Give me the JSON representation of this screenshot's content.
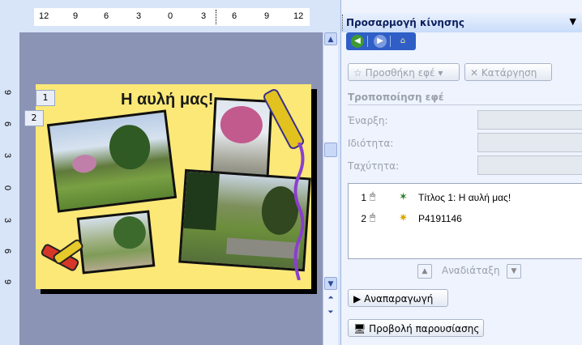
{
  "ruler": {
    "h_ticks": [
      "12",
      "9",
      "6",
      "3",
      "0",
      "3",
      "6",
      "9",
      "12"
    ],
    "v_ticks": [
      "9",
      "6",
      "3",
      "0",
      "3",
      "6",
      "9"
    ]
  },
  "slide": {
    "title": "Η αυλή μας!",
    "tags": [
      "1",
      "2"
    ],
    "background": "#fbe877"
  },
  "pane": {
    "title": "Προσαρμογή κίνησης",
    "menu_icon": "chevron-down-icon",
    "nav": [
      "back-icon",
      "forward-icon",
      "home-icon"
    ],
    "add_effect": "Προσθήκη εφέ",
    "remove": "Κατάργηση",
    "modify_heading": "Τροποποίηση εφέ",
    "start_label": "Έναρξη:",
    "property_label": "Ιδιότητα:",
    "speed_label": "Ταχύτητα:",
    "items": [
      {
        "num": "1",
        "text": "Τίτλος 1: Η αυλή μας!"
      },
      {
        "num": "2",
        "text": "P4191146"
      }
    ],
    "reorder_label": "Αναδιάταξη",
    "play_label": "Αναπαραγωγή",
    "slideshow_label": "Προβολή παρουσίασης"
  }
}
